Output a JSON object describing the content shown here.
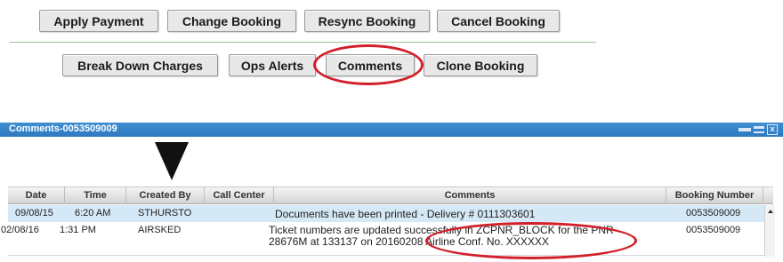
{
  "toolbar": {
    "row1": [
      "Apply Payment",
      "Change Booking",
      "Resync Booking",
      "Cancel Booking"
    ],
    "row2": [
      "Break Down Charges",
      "Ops Alerts",
      "Comments",
      "Clone Booking"
    ]
  },
  "dialog": {
    "title": "Comments-0053509009",
    "columns": [
      "Date",
      "Time",
      "Created By",
      "Call Center",
      "Comments",
      "Booking Number"
    ],
    "rows": [
      {
        "date": "09/08/15",
        "time": "6:20 AM",
        "created_by": "STHURSTO",
        "call_center": "",
        "comment": "Documents have been printed - Delivery # 0111303601",
        "booking_number": "0053509009"
      },
      {
        "date": "02/08/16",
        "time": "1:31 PM",
        "created_by": "AIRSKED",
        "call_center": "",
        "comment": "Ticket numbers are updated successfully in ZCPNR_BLOCK for the PNR 28676M at 133137 on 20160208 Airline Conf. No. XXXXXX",
        "booking_number": "0053509009"
      }
    ]
  },
  "colors": {
    "highlight": "#d21f2a",
    "titlebar": "#2f79bf",
    "selected_row": "#d5e8f6"
  },
  "icons": {
    "minimize": "minimize-icon",
    "maximize": "maximize-icon",
    "close": "close-icon",
    "pointer": "down-arrow-pointer-icon"
  }
}
